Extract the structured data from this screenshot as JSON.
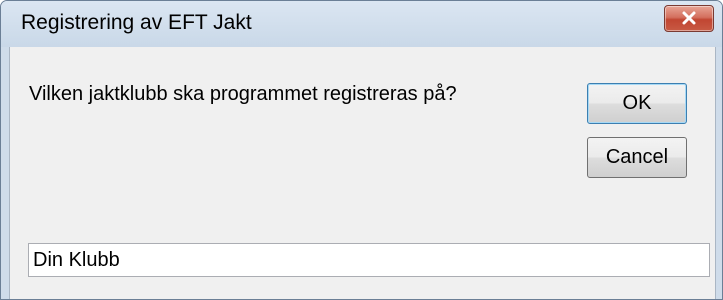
{
  "window": {
    "title": "Registrering av EFT Jakt",
    "close_icon": "close-icon",
    "close_color": "#c14632"
  },
  "dialog": {
    "prompt": "Vilken jaktklubb ska programmet registreras på?",
    "ok_label": "OK",
    "cancel_label": "Cancel",
    "input_value": "Din Klubb"
  }
}
